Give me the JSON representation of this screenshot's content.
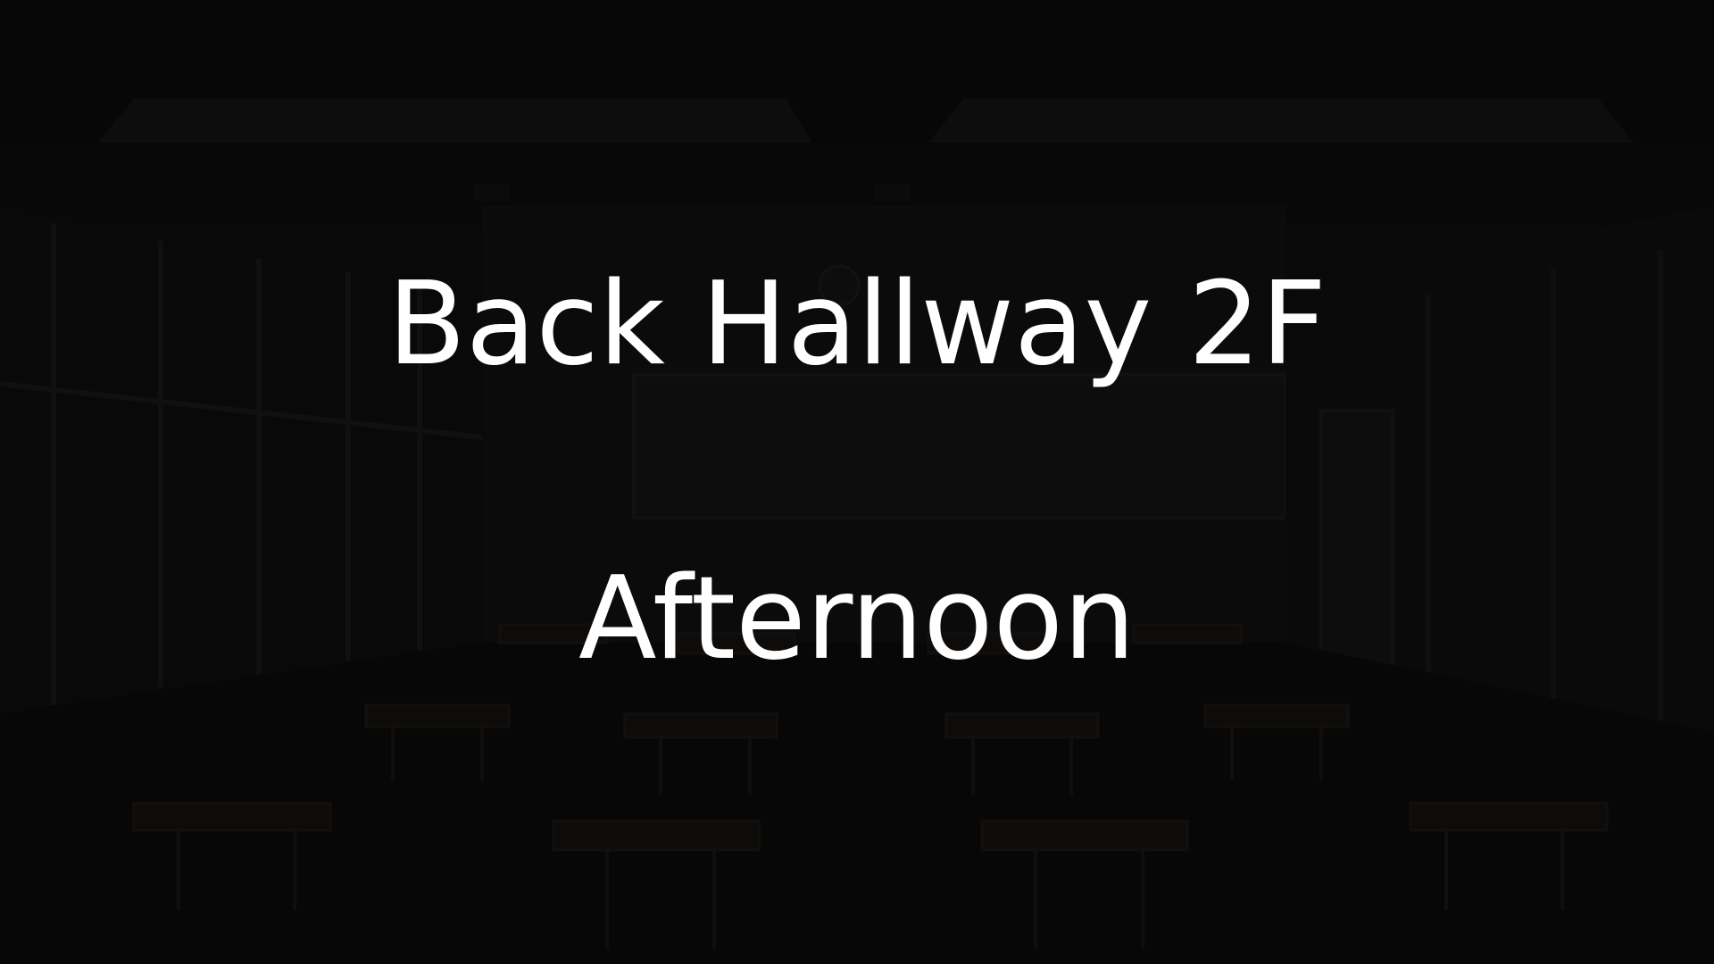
{
  "scene": {
    "location": "Back Hallway 2F",
    "time_of_day": "Afternoon",
    "background": "dark-classroom-art"
  }
}
